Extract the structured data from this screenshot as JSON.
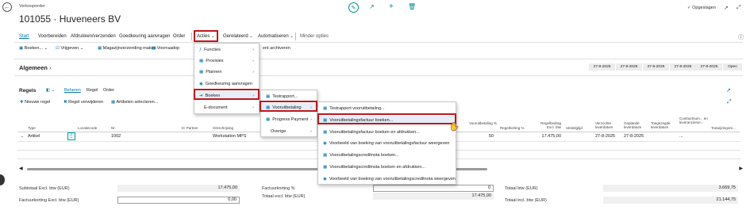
{
  "page": {
    "doc_type": "Verkooporder",
    "title": "101055 · Huveneers BV",
    "saved_status": "Opgeslagen",
    "colors": {
      "accent": "#0078a8",
      "highlight_box": "#c0161e",
      "cyan_icon": "#00a3a3"
    }
  },
  "nav": {
    "items": [
      "Start",
      "Voorbereiden",
      "Afdrukken/verzenden",
      "Goedkeuring aanvragen",
      "Order",
      "Acties",
      "Gerelateerd",
      "Automatiseren",
      "Minder opties"
    ]
  },
  "actionbar": {
    "items": [
      "Boeken...",
      "Vrijgeven",
      "Magazijnverzending maken",
      "Voorraadop",
      "ent archiveren"
    ]
  },
  "general": {
    "title": "Algemeen",
    "dates": [
      "27-8-2025",
      "27-8-2025",
      "27-8-2025",
      "27-8-2025",
      "27-8-2025",
      "27-8-2025"
    ],
    "status": "Open"
  },
  "lines": {
    "title": "Regels",
    "tabs": [
      "Beheren",
      "Regel",
      "Order"
    ],
    "actions": [
      "Nieuwe regel",
      "Regel verwijderen",
      "Artikelen selecteren..."
    ],
    "columns": [
      "Type",
      "Locatiecode",
      "Nr.",
      "IC Partner",
      "Omschrijving",
      "Vooruitbetaling %",
      "Regelkorting %",
      "Regelbedrag Excl. btw",
      "Uitstelgtijd",
      "Verzochte leverdatum",
      "Geplande leverdatum",
      "Toegezegde leverdatum",
      "Contractnum... en leverancierse...",
      "Toewijzingsre..."
    ],
    "row": {
      "type": "Artikel",
      "nr": "1002",
      "description": "Workstation MPS",
      "prepayment": "50",
      "amount": "17.475,00",
      "requested": "27-8-2025",
      "planned": "27-8-2025",
      "contract": "..."
    }
  },
  "totals": {
    "subtotal_label": "Subtotaal Excl. btw (EUR)",
    "subtotal": "17.475,00",
    "invdisc_amt_label": "Factuurkorting Excl. btw (EUR)",
    "invdisc_amt": "0,00",
    "invdisc_pct_label": "Factuurkorting %",
    "invdisc_pct": "0",
    "total_excl_label": "Totaal excl. btw (EUR)",
    "total_excl": "17.475,00",
    "total_vat_label": "Totaal btw (EUR)",
    "total_vat": "3.669,75",
    "total_incl_label": "Totaal incl. btw (EUR)",
    "total_incl": "21.144,75"
  },
  "menus": {
    "acties": [
      "Functies",
      "Provisies",
      "Plannen",
      "Goedkeuring aanvragen",
      "Boeken",
      "E-document"
    ],
    "boeken": [
      "Testrapport...",
      "Vooruitbetaling",
      "Progress Payment",
      "Overige"
    ],
    "vooruitbetaling": [
      "Testrapport vooruitbetaling...",
      "Vooruitbetalingsfactuur boeken...",
      "Vooruitbetalingsfactuur boeken en afdrukken...",
      "Voorbeeld van boeking van vooruitbetalingsfactuur weergeven",
      "Vooruitbetalingscreditnota boeken...",
      "Vooruitbetalingscreditnota boeken en afdrukken...",
      "Voorbeeld van boeking van vooruitbetalingscreditnota weergeven"
    ]
  }
}
